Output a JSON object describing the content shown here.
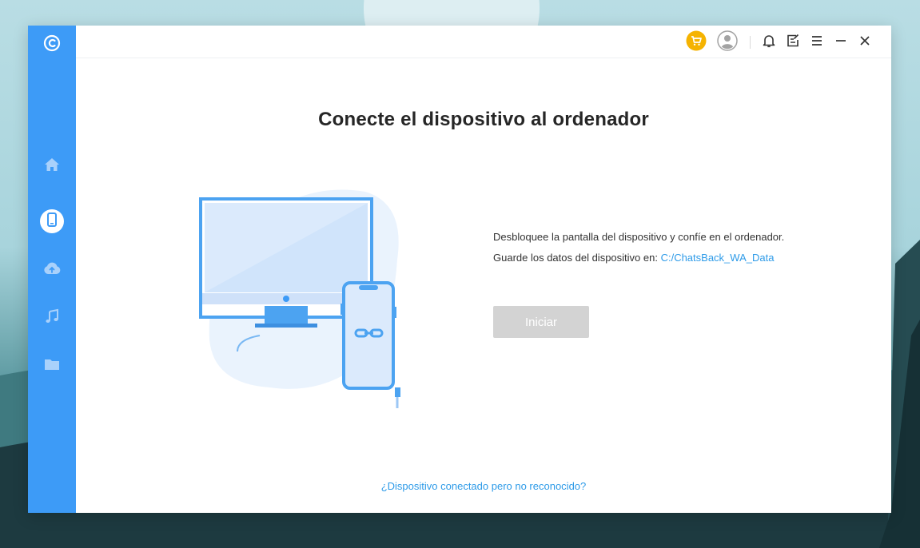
{
  "app": {
    "colors": {
      "sidebar": "#3d9bf7",
      "accent": "#2e9be8",
      "disabled_button": "#d3d3d3",
      "cart": "#f5b301"
    }
  },
  "sidebar": {
    "logo_icon": "chatsback-logo-icon",
    "items": [
      {
        "icon": "home-icon",
        "active": false
      },
      {
        "icon": "phone-icon",
        "active": true
      },
      {
        "icon": "cloud-icon",
        "active": false
      },
      {
        "icon": "music-icon",
        "active": false
      },
      {
        "icon": "folder-icon",
        "active": false
      }
    ]
  },
  "titlebar": {
    "icons": [
      "cart-icon",
      "account-icon",
      "bell-icon",
      "feedback-icon",
      "menu-icon",
      "minimize-icon",
      "close-icon"
    ]
  },
  "main": {
    "title": "Conecte el dispositivo al ordenador",
    "instruction": "Desbloquee la pantalla del dispositivo y confíe en el ordenador.",
    "save_label": "Guarde los datos del dispositivo en: ",
    "save_path": "C:/ChatsBack_WA_Data",
    "start_button": "Iniciar",
    "start_enabled": false,
    "help_link": "¿Dispositivo conectado pero no reconocido?"
  }
}
